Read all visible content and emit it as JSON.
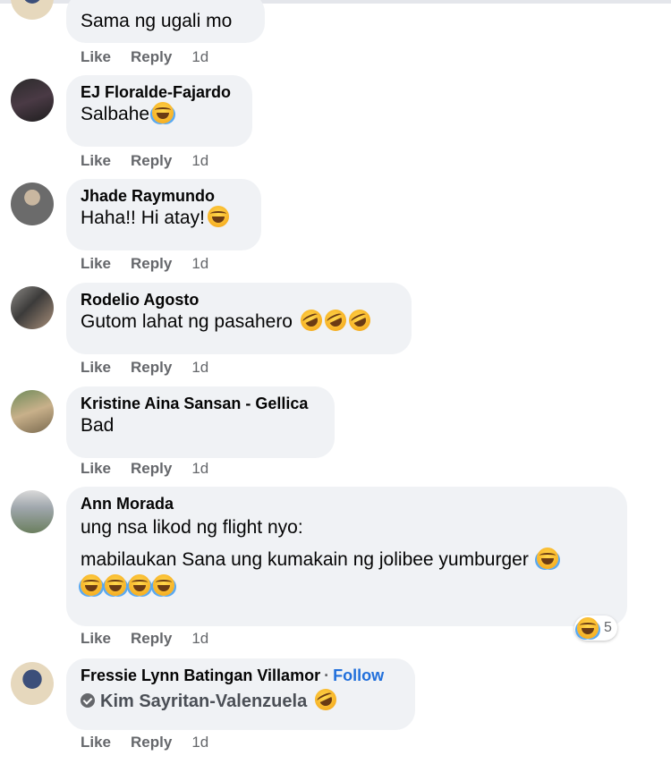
{
  "actions": {
    "like": "Like",
    "reply": "Reply",
    "time": "1d"
  },
  "comments": [
    {
      "author": "",
      "text": "Sama ng ugali mo",
      "emoji_count": 0
    },
    {
      "author": "EJ Floralde-Fajardo",
      "text": "Salbahe",
      "emoji_count": 1
    },
    {
      "author": "Jhade Raymundo",
      "text": "Haha!! Hi atay!",
      "emoji_count": 1
    },
    {
      "author": "Rodelio Agosto",
      "text": "Gutom lahat ng pasahero",
      "emoji_count": 3
    },
    {
      "author": "Kristine Aina Sansan - Gellica",
      "text": "Bad",
      "emoji_count": 0
    },
    {
      "author": "Ann Morada",
      "lines": [
        "ung nsa likod ng flight nyo:",
        "mabilaukan Sana ung kumakain ng jolibee yumburger"
      ],
      "trailing_emoji_count": 4,
      "reaction": {
        "icon": "laughing-emoji-icon",
        "count": "5"
      }
    },
    {
      "author": "Fressie Lynn Batingan Villamor",
      "separator": "·",
      "follow": "Follow",
      "mention": "Kim Sayritan-Valenzuela",
      "emoji_count": 1
    }
  ],
  "colors": {
    "bubble": "#f0f2f5",
    "meta": "#65676b",
    "follow": "#216fdb"
  }
}
